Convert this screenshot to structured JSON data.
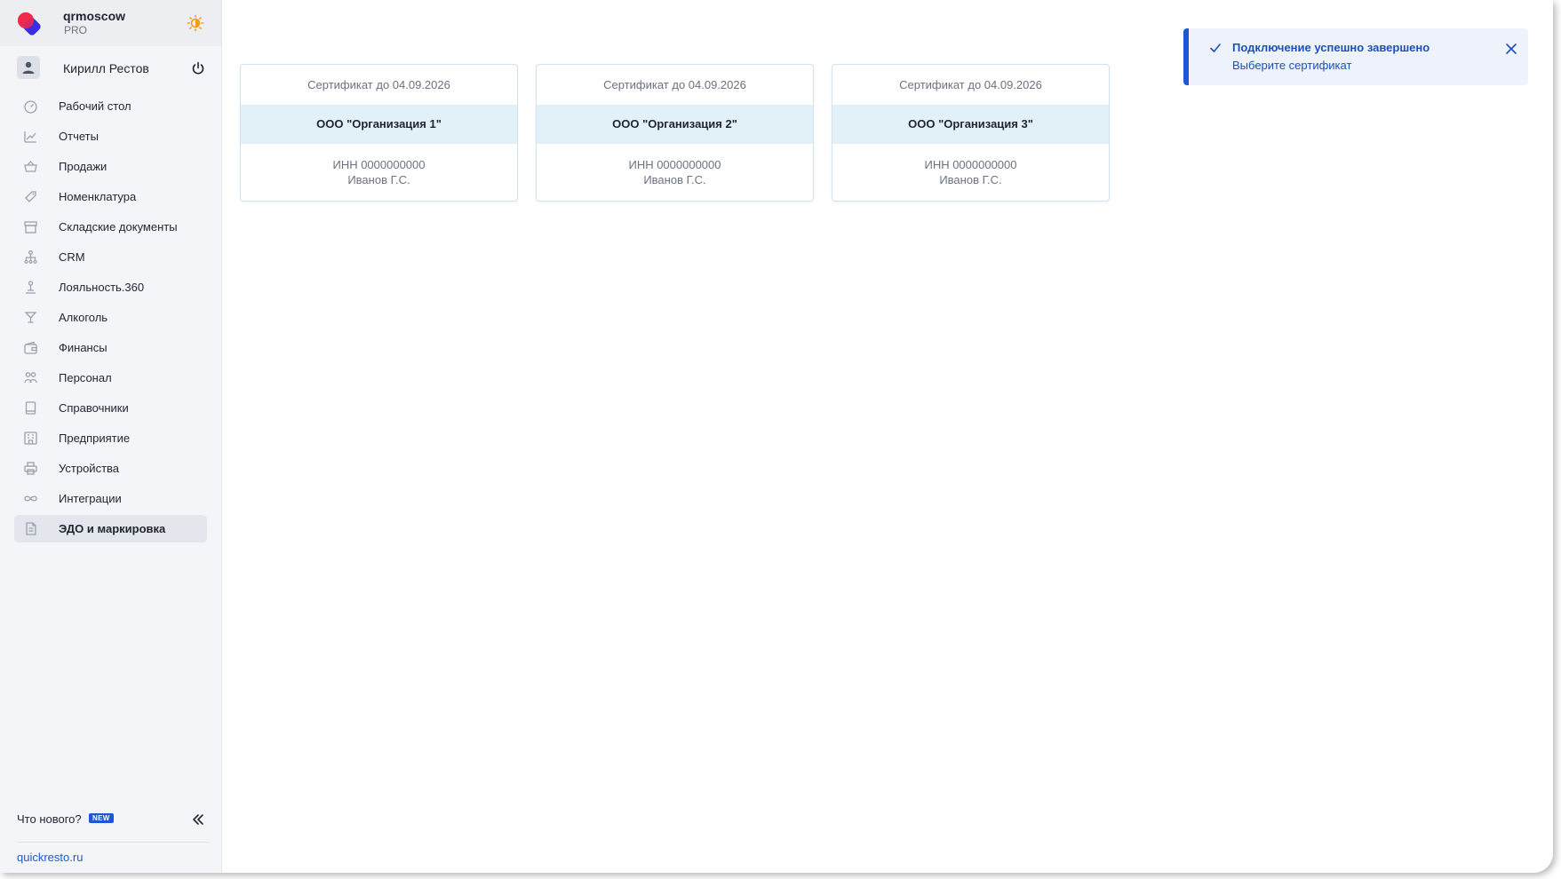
{
  "brand": {
    "name": "qrmoscow",
    "plan": "PRO"
  },
  "user": {
    "name": "Кирилл Рестов"
  },
  "nav": [
    {
      "label": "Рабочий стол",
      "icon": "dashboard-icon"
    },
    {
      "label": "Отчеты",
      "icon": "chart-icon"
    },
    {
      "label": "Продажи",
      "icon": "basket-icon"
    },
    {
      "label": "Номенклатура",
      "icon": "tag-icon"
    },
    {
      "label": "Складские документы",
      "icon": "box-icon"
    },
    {
      "label": "CRM",
      "icon": "hierarchy-icon"
    },
    {
      "label": "Лояльность.360",
      "icon": "loyalty-icon"
    },
    {
      "label": "Алкоголь",
      "icon": "glass-icon"
    },
    {
      "label": "Финансы",
      "icon": "wallet-icon"
    },
    {
      "label": "Персонал",
      "icon": "people-icon"
    },
    {
      "label": "Справочники",
      "icon": "book-icon"
    },
    {
      "label": "Предприятие",
      "icon": "building-icon"
    },
    {
      "label": "Устройства",
      "icon": "printer-icon"
    },
    {
      "label": "Интеграции",
      "icon": "infinity-icon"
    },
    {
      "label": "ЭДО и маркировка",
      "icon": "document-icon",
      "active": true
    }
  ],
  "footer": {
    "whats_new": "Что нового?",
    "badge": "NEW",
    "site": "quickresto.ru"
  },
  "cards": [
    {
      "cert": "Сертификат до 04.09.2026",
      "org": "ООО \"Организация 1\"",
      "inn": "ИНН 0000000000",
      "person": "Иванов Г.С."
    },
    {
      "cert": "Сертификат до 04.09.2026",
      "org": "ООО \"Организация 2\"",
      "inn": "ИНН 0000000000",
      "person": "Иванов Г.С."
    },
    {
      "cert": "Сертификат до 04.09.2026",
      "org": "ООО \"Организация 3\"",
      "inn": "ИНН 0000000000",
      "person": "Иванов Г.С."
    }
  ],
  "toast": {
    "title": "Подключение успешно завершено",
    "subtitle": "Выберите сертификат"
  },
  "colors": {
    "accent": "#1e56d6",
    "sidebar_bg": "#f3f5f8",
    "org_band": "#e2f0f8",
    "logo_red": "#ee2a4a",
    "logo_blue": "#3b2ee0",
    "theme_orange": "#f29d13"
  }
}
